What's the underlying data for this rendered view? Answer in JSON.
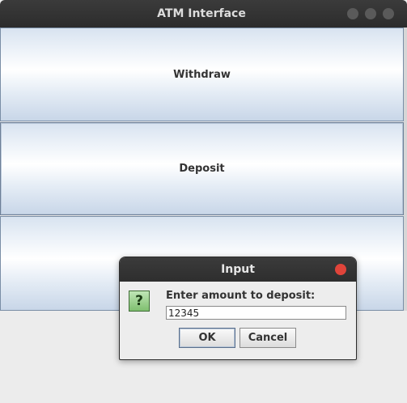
{
  "window": {
    "title": "ATM Interface"
  },
  "buttons": {
    "withdraw": "Withdraw",
    "deposit": "Deposit",
    "third": ""
  },
  "dialog": {
    "title": "Input",
    "icon": "question-icon",
    "icon_glyph": "?",
    "prompt": "Enter amount to deposit:",
    "input_value": "12345",
    "ok_label": "OK",
    "cancel_label": "Cancel"
  },
  "colors": {
    "titlebar": "#2e2e2e",
    "close": "#e0443a",
    "button_border": "#7a8ea6"
  }
}
